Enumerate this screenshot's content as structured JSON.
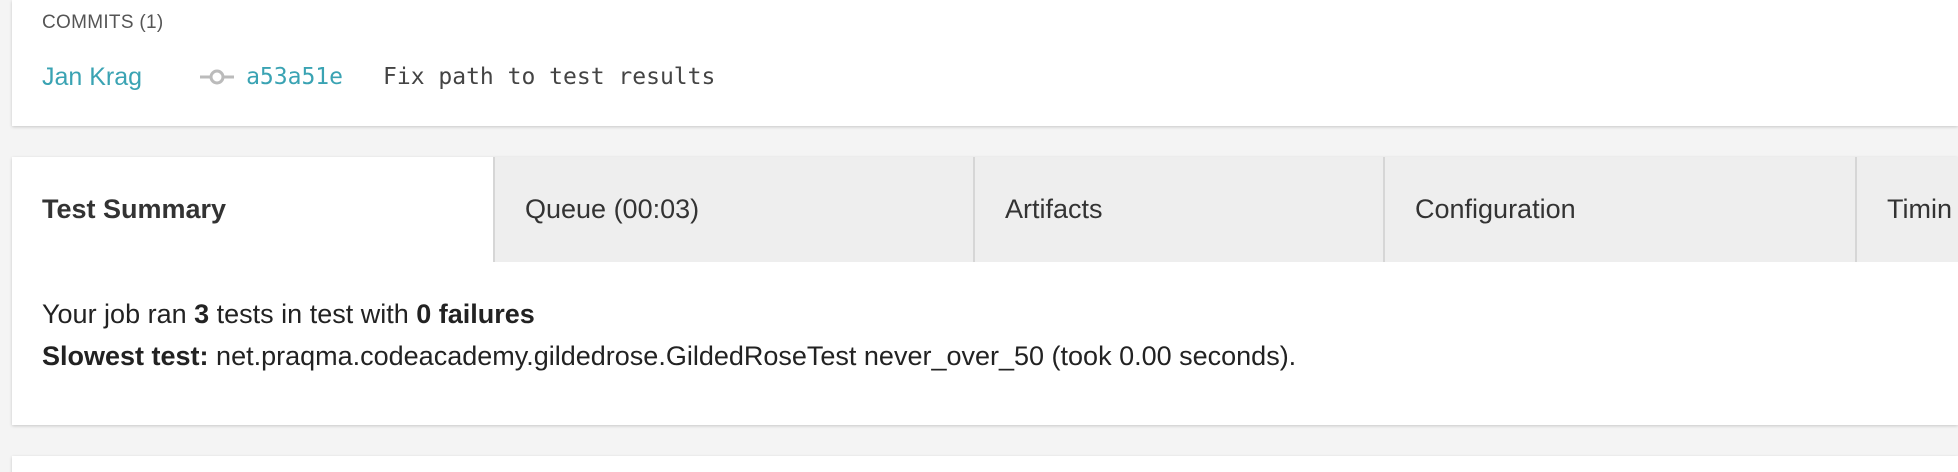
{
  "commits": {
    "header": "COMMITS (1)",
    "items": [
      {
        "author": "Jan Krag",
        "hash": "a53a51e",
        "message": "Fix path to test results"
      }
    ],
    "icon": "commit-icon"
  },
  "tabs": [
    {
      "label": "Test Summary",
      "active": true
    },
    {
      "label": "Queue (00:03)",
      "active": false
    },
    {
      "label": "Artifacts",
      "active": false
    },
    {
      "label": "Configuration",
      "active": false
    },
    {
      "label": "Timin",
      "active": false
    }
  ],
  "summary": {
    "line1": {
      "prefix": "Your job ran ",
      "test_count": "3",
      "middle": " tests in test with ",
      "failures": "0 failures"
    },
    "line2": {
      "label": "Slowest test:",
      "detail": " net.praqma.codeacademy.gildedrose.GildedRoseTest never_over_50 (took 0.00 seconds)."
    }
  },
  "colors": {
    "link": "#3aa3b3",
    "background": "#f4f4f4",
    "tab_inactive": "#eeeeee"
  }
}
